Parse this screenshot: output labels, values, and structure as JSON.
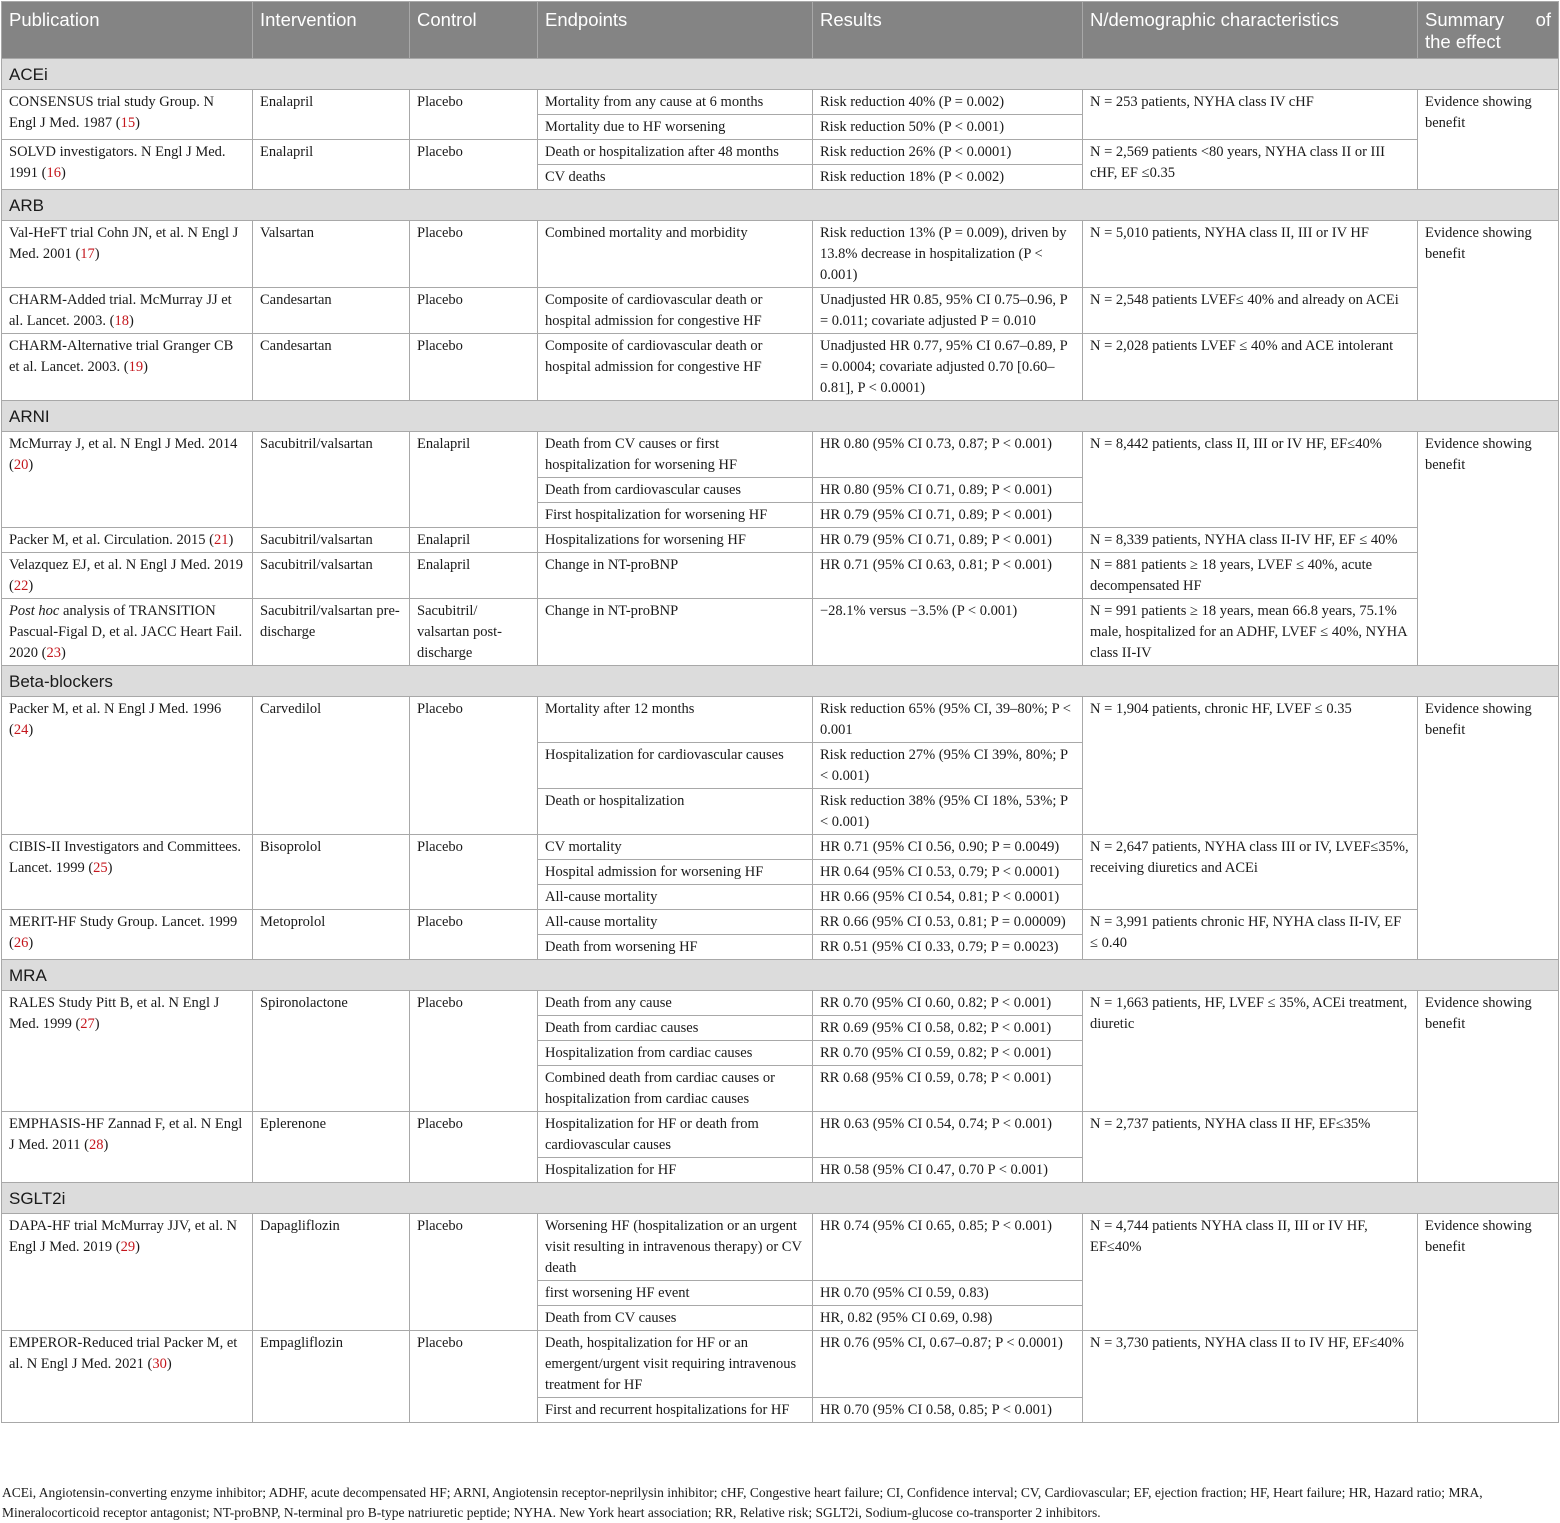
{
  "header": {
    "publication": "Publication",
    "intervention": "Intervention",
    "control": "Control",
    "endpoints": "Endpoints",
    "results": "Results",
    "demographics": "N/demographic characteristics",
    "summary_1": "Summary",
    "summary_2": "of",
    "summary_3": "the effect"
  },
  "sections": {
    "acei": "ACEi",
    "arb": "ARB",
    "arni": "ARNI",
    "bb": "Beta-blockers",
    "mra": "MRA",
    "sglt2i": "SGLT2i"
  },
  "summary": "Evidence showing benefit",
  "acei": {
    "consensus": {
      "pub": "CONSENSUS trial study Group. N Engl J Med. 1987 (",
      "ref": "15",
      "intervention": "Enalapril",
      "control": "Placebo",
      "e1": "Mortality from any cause at 6 months",
      "r1": "Risk reduction 40% (P = 0.002)",
      "e2": "Mortality due to HF worsening",
      "r2": "Risk reduction 50% (P < 0.001)",
      "n": "N = 253 patients, NYHA class IV cHF"
    },
    "solvd": {
      "pub": "SOLVD investigators. N Engl J Med. 1991 (",
      "ref": "16",
      "intervention": "Enalapril",
      "control": "Placebo",
      "e1": "Death or hospitalization after 48 months",
      "r1": "Risk reduction 26% (P < 0.0001)",
      "e2": "CV deaths",
      "r2": "Risk reduction 18% (P < 0.002)",
      "n": "N = 2,569 patients <80 years, NYHA class II or III cHF, EF ≤0.35"
    }
  },
  "arb": {
    "valheft": {
      "pub": "Val-HeFT trial Cohn JN, et al. N Engl J Med. 2001 (",
      "ref": "17",
      "intervention": "Valsartan",
      "control": "Placebo",
      "e1": "Combined mortality and morbidity",
      "r1": "Risk reduction 13% (P = 0.009), driven by 13.8% decrease in hospitalization (P < 0.001)",
      "n": "N = 5,010 patients, NYHA class II, III or IV HF"
    },
    "charm_added": {
      "pub": "CHARM-Added trial. McMurray JJ et al. Lancet. 2003. (",
      "ref": "18",
      "intervention": "Candesartan",
      "control": "Placebo",
      "e1": "Composite of cardiovascular death or hospital admission for congestive HF",
      "r1": "Unadjusted HR 0.85, 95% CI 0.75–0.96, P = 0.011; covariate adjusted P = 0.010",
      "n": "N = 2,548 patients LVEF≤ 40% and already on ACEi"
    },
    "charm_alt": {
      "pub": "CHARM-Alternative trial Granger CB et al. Lancet. 2003. (",
      "ref": "19",
      "intervention": "Candesartan",
      "control": "Placebo",
      "e1": "Composite of cardiovascular death or hospital admission for congestive HF",
      "r1": "Unadjusted HR 0.77, 95% CI 0.67–0.89, P = 0.0004; covariate adjusted 0.70 [0.60–0.81], P < 0.0001)",
      "n": "N = 2,028 patients LVEF ≤ 40% and ACE intolerant"
    }
  },
  "arni": {
    "mcmurray": {
      "pub": "McMurray J, et al. N Engl J Med. 2014 (",
      "ref": "20",
      "intervention": "Sacubitril/valsartan",
      "control": "Enalapril",
      "e1": "Death from CV causes or first hospitalization for worsening HF",
      "r1": "HR 0.80 (95% CI 0.73, 0.87; P < 0.001)",
      "e2": "Death from cardiovascular causes",
      "r2": "HR 0.80 (95% CI 0.71, 0.89; P < 0.001)",
      "e3": "First hospitalization for worsening HF",
      "r3": "HR 0.79 (95% CI 0.71, 0.89; P < 0.001)",
      "n": "N = 8,442 patients, class II, III or IV HF, EF≤40%"
    },
    "packer": {
      "pub": "Packer M, et al. Circulation. 2015 (",
      "ref": "21",
      "intervention": "Sacubitril/valsartan",
      "control": "Enalapril",
      "e1": "Hospitalizations for worsening HF",
      "r1": "HR 0.79 (95% CI 0.71, 0.89; P < 0.001)",
      "n": "N = 8,339 patients, NYHA class II-IV HF, EF ≤ 40%"
    },
    "velazquez": {
      "pub": "Velazquez EJ, et al. N Engl J Med. 2019 (",
      "ref": "22",
      "intervention": "Sacubitril/valsartan",
      "control": "Enalapril",
      "e1": "Change in NT-proBNP",
      "r1": "HR 0.71 (95% CI 0.63, 0.81; P < 0.001)",
      "n": "N = 881 patients ≥ 18 years, LVEF ≤ 40%, acute decompensated HF"
    },
    "transition": {
      "pub_italic": "Post hoc",
      "pub": " analysis of TRANSITION Pascual-Figal D, et al. JACC Heart Fail. 2020 (",
      "ref": "23",
      "intervention": "Sacubitril/valsartan pre-discharge",
      "control": "Sacubitril/ valsartan post-discharge",
      "e1": "Change in NT-proBNP",
      "r1": "−28.1% versus −3.5% (P < 0.001)",
      "n": "N = 991 patients ≥ 18 years, mean 66.8 years, 75.1% male, hospitalized for an ADHF, LVEF ≤ 40%, NYHA class II-IV"
    }
  },
  "bb": {
    "packer": {
      "pub": "Packer M, et al. N Engl J Med. 1996 (",
      "ref": "24",
      "intervention": "Carvedilol",
      "control": "Placebo",
      "e1": "Mortality after 12 months",
      "r1": "Risk reduction 65% (95% CI, 39–80%; P < 0.001",
      "e2": "Hospitalization for cardiovascular causes",
      "r2": "Risk reduction 27% (95% CI 39%, 80%; P < 0.001)",
      "e3": "Death or hospitalization",
      "r3": "Risk reduction 38% (95% CI 18%, 53%; P < 0.001)",
      "n": "N = 1,904 patients, chronic HF, LVEF ≤ 0.35"
    },
    "cibis": {
      "pub": "CIBIS-II Investigators and Committees. Lancet. 1999 (",
      "ref": "25",
      "intervention": "Bisoprolol",
      "control": "Placebo",
      "e1": "CV mortality",
      "r1": "HR 0.71 (95% CI 0.56, 0.90; P = 0.0049)",
      "e2": "Hospital admission for worsening HF",
      "r2": "HR 0.64 (95% CI 0.53, 0.79; P < 0.0001)",
      "e3": "All-cause mortality",
      "r3": "HR 0.66 (95% CI 0.54, 0.81; P < 0.0001)",
      "n": "N = 2,647 patients, NYHA class III or IV, LVEF≤35%, receiving diuretics and ACEi"
    },
    "merit": {
      "pub": "MERIT-HF Study Group. Lancet. 1999 (",
      "ref": "26",
      "intervention": "Metoprolol",
      "control": "Placebo",
      "e1": "All-cause mortality",
      "r1": "RR 0.66 (95% CI 0.53, 0.81; P = 0.00009)",
      "e2": "Death from worsening HF",
      "r2": "RR 0.51 (95% CI 0.33, 0.79; P = 0.0023)",
      "n": "N = 3,991 patients chronic HF, NYHA class II-IV, EF ≤ 0.40"
    }
  },
  "mra": {
    "rales": {
      "pub": "RALES Study Pitt B, et al. N Engl J Med. 1999 (",
      "ref": "27",
      "intervention": "Spironolactone",
      "control": "Placebo",
      "e1": "Death from any cause",
      "r1": "RR 0.70 (95% CI 0.60, 0.82; P < 0.001)",
      "e2": "Death from cardiac causes",
      "r2": "RR 0.69 (95% CI 0.58, 0.82; P < 0.001)",
      "e3": "Hospitalization from cardiac causes",
      "r3": "RR 0.70 (95% CI 0.59, 0.82; P < 0.001)",
      "e4": "Combined death from cardiac causes or hospitalization from cardiac causes",
      "r4": "RR 0.68 (95% CI 0.59, 0.78; P < 0.001)",
      "n": "N = 1,663 patients, HF, LVEF ≤ 35%, ACEi treatment, diuretic"
    },
    "emphasis": {
      "pub": "EMPHASIS-HF Zannad F, et al. N Engl J Med. 2011 (",
      "ref": "28",
      "intervention": "Eplerenone",
      "control": "Placebo",
      "e1": "Hospitalization for HF or death from cardiovascular causes",
      "r1": "HR 0.63 (95% CI 0.54, 0.74; P < 0.001)",
      "e2": "Hospitalization for HF",
      "r2": "HR 0.58 (95% CI 0.47, 0.70 P < 0.001)",
      "n": "N = 2,737 patients, NYHA class II HF, EF≤35%"
    }
  },
  "sglt2i": {
    "dapa": {
      "pub": "DAPA-HF trial McMurray JJV, et al. N Engl J Med. 2019 (",
      "ref": "29",
      "intervention": "Dapagliflozin",
      "control": "Placebo",
      "e1": "Worsening HF (hospitalization or an urgent visit resulting in intravenous therapy) or CV death",
      "r1": "HR 0.74 (95% CI 0.65, 0.85; P < 0.001)",
      "e2": "first worsening HF event",
      "r2": "HR 0.70 (95% CI 0.59, 0.83)",
      "e3": "Death from CV causes",
      "r3": "HR, 0.82 (95% CI 0.69, 0.98)",
      "n": "N = 4,744 patients NYHA class II, III or IV HF, EF≤40%"
    },
    "emperor": {
      "pub": "EMPEROR-Reduced trial Packer M, et al. N Engl J Med. 2021 (",
      "ref": "30",
      "intervention": "Empagliflozin",
      "control": "Placebo",
      "e1": "Death, hospitalization for HF or an emergent/urgent visit requiring intravenous treatment for HF",
      "r1": "HR 0.76 (95% CI, 0.67–0.87; P < 0.0001)",
      "e2": "First and recurrent hospitalizations for HF",
      "r2": "HR 0.70 (95% CI 0.58, 0.85; P < 0.001)",
      "n": "N = 3,730 patients, NYHA class II to IV HF, EF≤40%"
    }
  },
  "close_paren": ")",
  "footnote": "ACEi, Angiotensin-converting enzyme inhibitor; ADHF, acute decompensated HF; ARNI, Angiotensin receptor-neprilysin inhibitor; cHF, Congestive heart failure; CI, Confidence interval; CV, Cardiovascular; EF, ejection fraction; HF, Heart failure; HR, Hazard ratio; MRA, Mineralocorticoid receptor antagonist; NT-proBNP, N-terminal pro B-type natriuretic peptide; NYHA. New York heart association; RR, Relative risk; SGLT2i, Sodium-glucose co-transporter 2 inhibitors."
}
